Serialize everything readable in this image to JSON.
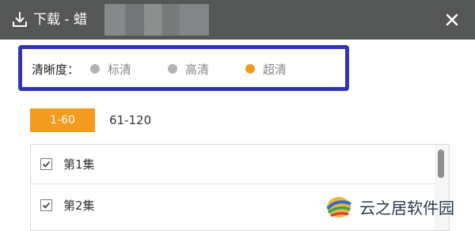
{
  "window": {
    "title": "下载 - 蜡",
    "title_icon": "download-icon",
    "close_icon": "close-icon"
  },
  "resolution": {
    "label": "清晰度：",
    "options": [
      {
        "label": "标清",
        "selected": false,
        "dot_color": "#b3b3b3"
      },
      {
        "label": "高清",
        "selected": false,
        "dot_color": "#b3b3b3"
      },
      {
        "label": "超清",
        "selected": true,
        "dot_color": "#f39a1f"
      }
    ]
  },
  "ranges": [
    {
      "label": "1-60",
      "active": true
    },
    {
      "label": "61-120",
      "active": false
    }
  ],
  "episodes": [
    {
      "label": "第1集",
      "checked": true
    },
    {
      "label": "第2集",
      "checked": true
    }
  ],
  "watermark": {
    "text": "云之居软件园"
  },
  "colors": {
    "titlebar": "#555656",
    "accent": "#f39a1f",
    "highlight": "#3333b8"
  }
}
